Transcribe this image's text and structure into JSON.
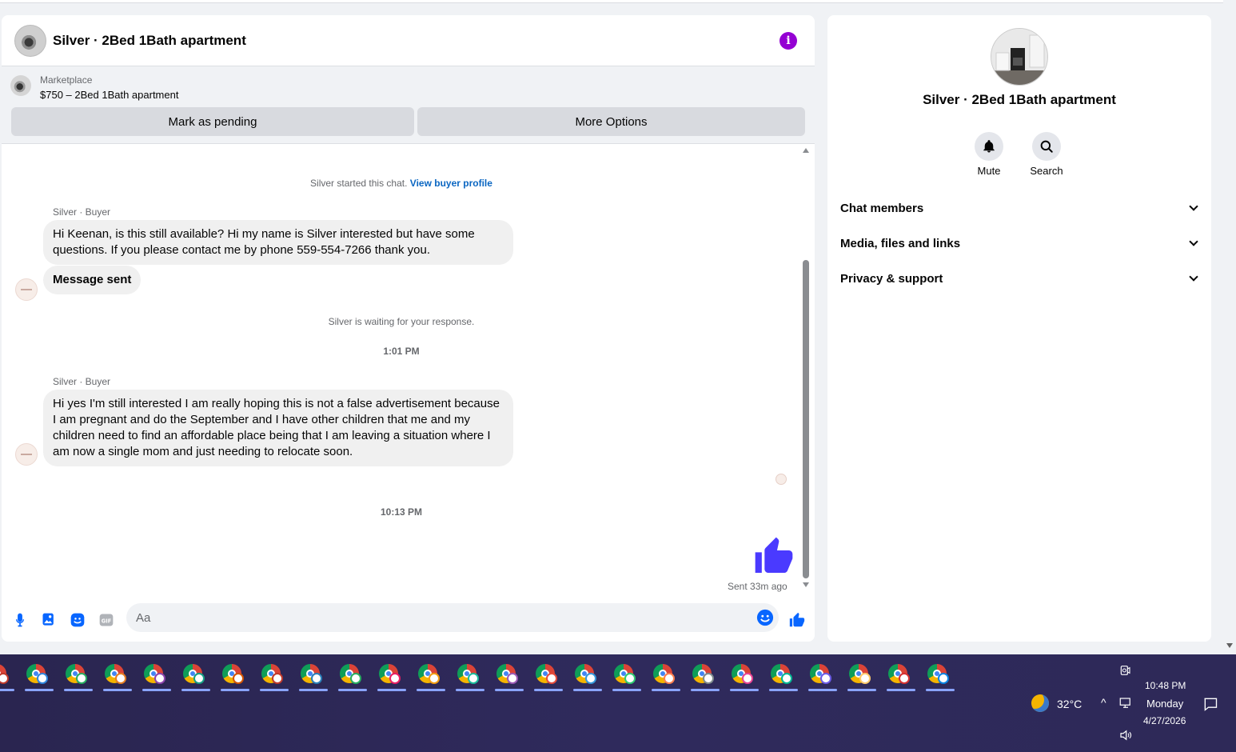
{
  "chat": {
    "title": "Silver · 2Bed 1Bath apartment",
    "marketplace_label": "Marketplace",
    "listing": "$750 – 2Bed 1Bath apartment",
    "buttons": {
      "pending": "Mark as pending",
      "more": "More Options"
    },
    "started_text": "Silver started this chat.",
    "view_profile": "View buyer profile",
    "messages": [
      {
        "sender": "Silver · Buyer",
        "text": "Hi Keenan, is this still available? Hi my name is Silver interested but have some questions. If you please contact me by phone 559-554-7266 thank you."
      },
      {
        "text": "Message sent"
      },
      {
        "sender": "Silver · Buyer",
        "text": "Hi yes I'm still interested I am really hoping this is not a false advertisement because I am pregnant and do the September and I have other children that me and my children need to find an affordable place being that I am leaving a situation where I am now a single mom and just needing to relocate soon."
      }
    ],
    "waiting_text": "Silver is waiting for your response.",
    "time1": "1:01 PM",
    "time2": "10:13 PM",
    "sent_status": "Sent 33m ago",
    "composer_placeholder": "Aa",
    "accent_color": "#0866ff",
    "like_color": "#4a3aff"
  },
  "details": {
    "title": "Silver · 2Bed 1Bath apartment",
    "mute": "Mute",
    "search": "Search",
    "sections": [
      "Chat members",
      "Media, files and links",
      "Privacy & support"
    ]
  },
  "taskbar": {
    "app_count": 25,
    "app_icon": "chrome-profile-icon",
    "temperature": "32°C",
    "time": "10:48 PM",
    "day": "Monday",
    "date": "4/27/2026"
  }
}
